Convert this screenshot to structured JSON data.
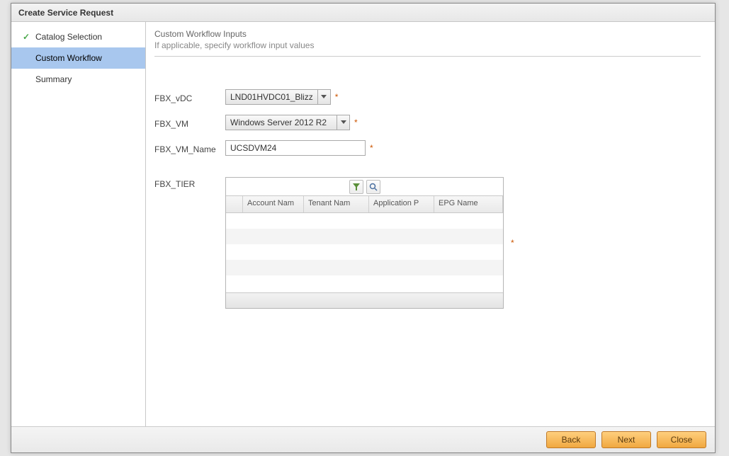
{
  "dialog": {
    "title": "Create Service Request"
  },
  "steps": {
    "catalog": "Catalog Selection",
    "workflow": "Custom Workflow",
    "summary": "Summary"
  },
  "header": {
    "title": "Custom Workflow Inputs",
    "subtitle": "If applicable, specify workflow input values"
  },
  "form": {
    "vdc_label": "FBX_vDC",
    "vdc_value": "LND01HVDC01_Blizz",
    "vm_label": "FBX_VM",
    "vm_value": "Windows Server 2012 R2",
    "vmname_label": "FBX_VM_Name",
    "vmname_value": "UCSDVM24",
    "tier_label": "FBX_TIER",
    "required_marker": "*"
  },
  "grid": {
    "cols": [
      "Account Nam",
      "Tenant Nam",
      "Application P",
      "EPG Name"
    ]
  },
  "buttons": {
    "back": "Back",
    "next": "Next",
    "close": "Close"
  }
}
